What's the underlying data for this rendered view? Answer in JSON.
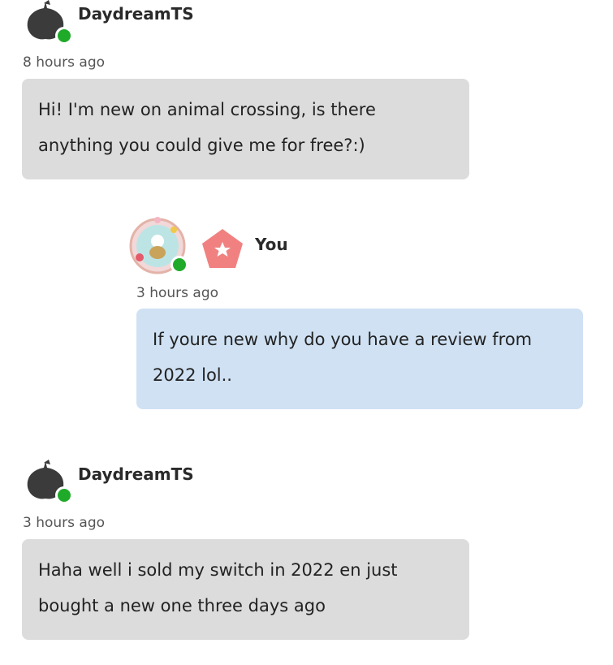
{
  "messages": [
    {
      "author": "DaydreamTS",
      "time": "8 hours ago",
      "text": "Hi! I'm new on animal crossing, is there anything you could give me for free?:)",
      "side": "left",
      "avatar": "leaf-icon",
      "online": true
    },
    {
      "author": "You",
      "time": "3 hours ago",
      "text": "If youre new why do you have a review from 2022 lol..",
      "side": "right",
      "avatar": "ornate-villager-avatar",
      "badge": "red-pentagon-star-badge",
      "online": true
    },
    {
      "author": "DaydreamTS",
      "time": "3 hours ago",
      "text": "Haha well i sold my switch in 2022 en just bought a new one three days ago",
      "side": "left",
      "avatar": "leaf-icon",
      "online": true
    }
  ],
  "colors": {
    "bubble_other": "#dcdcdc",
    "bubble_self": "#cfe1f3",
    "online": "#1faa2a",
    "badge": "#ee6b6b",
    "leaf": "#3b3b3b"
  }
}
